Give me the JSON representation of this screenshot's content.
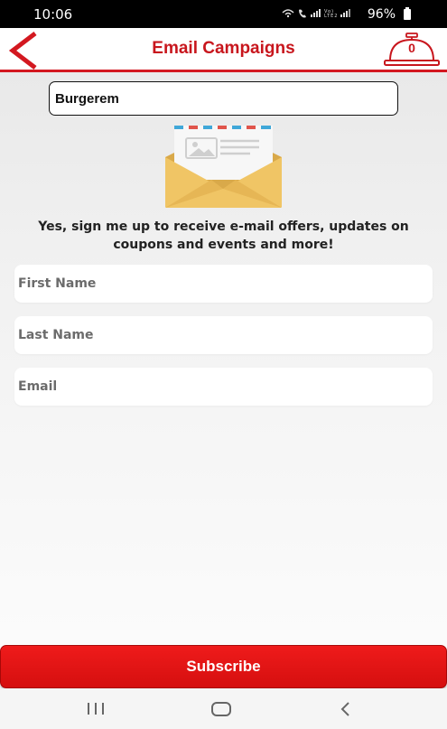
{
  "status_bar": {
    "time": "10:06",
    "icons": [
      "wifi-icon",
      "call-icon",
      "signal-icon",
      "volte-icon",
      "signal-icon"
    ],
    "battery": "96%"
  },
  "header": {
    "title": "Email Campaigns",
    "cart_count": "0",
    "accent_color": "#d31820"
  },
  "store": {
    "name": "Burgerem"
  },
  "signup": {
    "message": "Yes, sign me up to receive e-mail offers, updates on coupons and events and more!"
  },
  "form": {
    "first_name_placeholder": "First Name",
    "last_name_placeholder": "Last Name",
    "email_placeholder": "Email",
    "first_name_value": "",
    "last_name_value": "",
    "email_value": ""
  },
  "actions": {
    "subscribe_label": "Subscribe"
  },
  "nav": {
    "icons": [
      "recent-apps-icon",
      "home-icon",
      "back-nav-icon"
    ]
  }
}
